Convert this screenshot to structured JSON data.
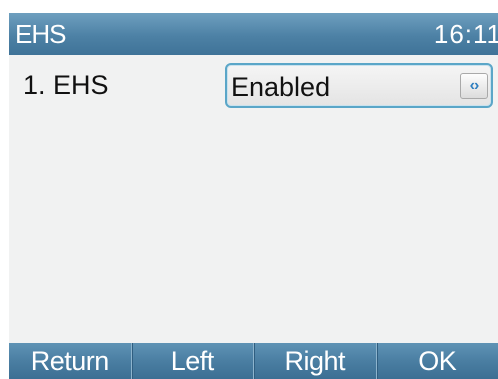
{
  "title_bar": {
    "title": "EHS",
    "time": "16:11"
  },
  "settings": [
    {
      "label": "1. EHS",
      "value": "Enabled",
      "control_icon": "left-right-arrows-icon",
      "control_glyph": "‹›"
    }
  ],
  "softkeys": {
    "return_label": "Return",
    "left_label": "Left",
    "right_label": "Right",
    "ok_label": "OK"
  },
  "colors": {
    "title_bar": "#4d81a5",
    "softkey_bar": "#4a7ea2",
    "background": "#f1f2f2",
    "focus_border": "#5aa6c8",
    "arrow": "#2f7fc0"
  }
}
